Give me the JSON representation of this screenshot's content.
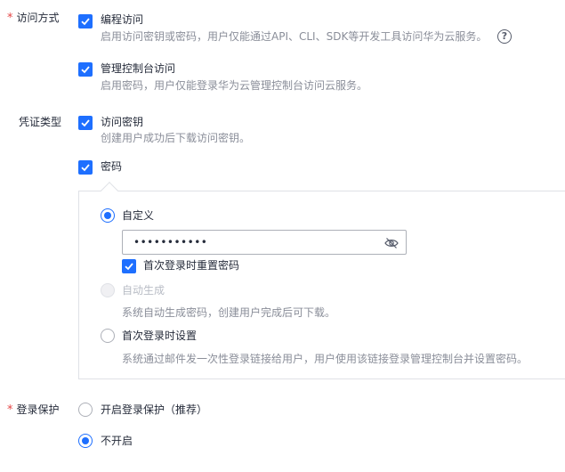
{
  "access_method": {
    "label": "访问方式",
    "required": true,
    "programmatic": {
      "title": "编程访问",
      "desc": "启用访问密钥或密码，用户仅能通过API、CLI、SDK等开发工具访问华为云服务。",
      "checked": true
    },
    "console": {
      "title": "管理控制台访问",
      "desc": "启用密码，用户仅能登录华为云管理控制台访问云服务。",
      "checked": true
    },
    "help_icon": "question-circle-icon"
  },
  "credential_type": {
    "label": "凭证类型",
    "access_key": {
      "title": "访问密钥",
      "desc": "创建用户成功后下载访问密钥。",
      "checked": true
    },
    "password": {
      "title": "密码",
      "checked": true
    }
  },
  "password_panel": {
    "custom": {
      "label": "自定义",
      "selected": true
    },
    "password_value": "•••••••••••",
    "eye_icon": "eye-off-icon",
    "reset_on_first_login": {
      "label": "首次登录时重置密码",
      "checked": true
    },
    "auto_generate": {
      "label": "自动生成",
      "desc": "系统自动生成密码，创建用户完成后可下载。",
      "disabled": true
    },
    "first_login_set": {
      "label": "首次登录时设置",
      "desc": "系统通过邮件发一次性登录链接给用户，用户使用该链接登录管理控制台并设置密码。",
      "selected": false
    }
  },
  "login_protection": {
    "label": "登录保护",
    "required": true,
    "enable": {
      "label": "开启登录保护（推荐）",
      "selected": false
    },
    "disable": {
      "label": "不开启",
      "selected": true
    }
  },
  "colors": {
    "primary": "#1e6fff",
    "required_star": "#e54545",
    "desc_text": "#8a8e99"
  }
}
